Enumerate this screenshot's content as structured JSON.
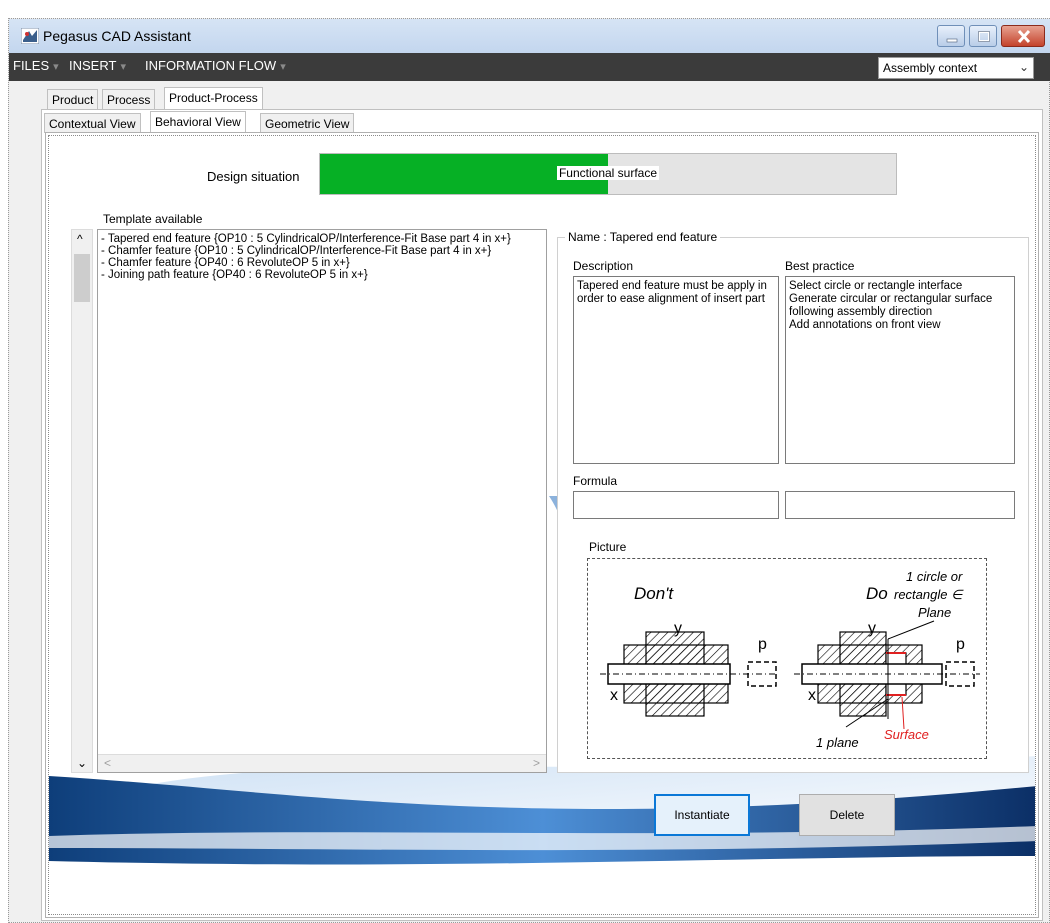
{
  "window": {
    "title": "Pegasus CAD Assistant"
  },
  "menu": {
    "items": [
      {
        "label": "FILES"
      },
      {
        "label": "INSERT"
      },
      {
        "label": "INFORMATION FLOW"
      }
    ],
    "context_select": {
      "value": "Assembly context"
    }
  },
  "tabs": {
    "top": [
      {
        "label": "Product"
      },
      {
        "label": "Process"
      },
      {
        "label": "Product-Process",
        "active": true
      }
    ],
    "views": [
      {
        "label": "Contextual View"
      },
      {
        "label": "Behavioral View",
        "active": true
      },
      {
        "label": "Geometric View"
      }
    ]
  },
  "design_situation": {
    "label": "Design situation",
    "status_text": "Functional surface",
    "progress_fraction": 0.5,
    "fill_color": "#06b025"
  },
  "templates": {
    "label": "Template available",
    "items": [
      "- Tapered end feature {OP10 : 5 CylindricalOP/Interference-Fit Base part 4 in x+}",
      "- Chamfer feature {OP10 : 5 CylindricalOP/Interference-Fit Base part 4 in x+}",
      "- Chamfer feature {OP40 : 6 RevoluteOP 5 in x+}",
      "- Joining path feature {OP40 : 6 RevoluteOP 5 in x+}"
    ]
  },
  "detail": {
    "name_label": "Name : Tapered end feature",
    "description_label": "Description",
    "description_text": "Tapered end feature must be apply in order to ease alignment of insert part",
    "best_practice_label": "Best practice",
    "best_practice_lines": [
      "Select circle or rectangle interface",
      "Generate circular or rectangular surface following assembly direction",
      "Add annotations on front view"
    ],
    "formula_label": "Formula",
    "formula_value_1": "",
    "formula_value_2": "",
    "picture_label": "Picture",
    "picture": {
      "dont": "Don't",
      "do": "Do",
      "note_line1": "1 circle or",
      "note_line2": "rectangle ∈",
      "note_line3": "Plane",
      "y": "y",
      "p": "p",
      "x": "x",
      "plane": "1 plane",
      "surface": "Surface",
      "surface_color": "#e02020"
    }
  },
  "buttons": {
    "instantiate": "Instantiate",
    "delete": "Delete"
  }
}
